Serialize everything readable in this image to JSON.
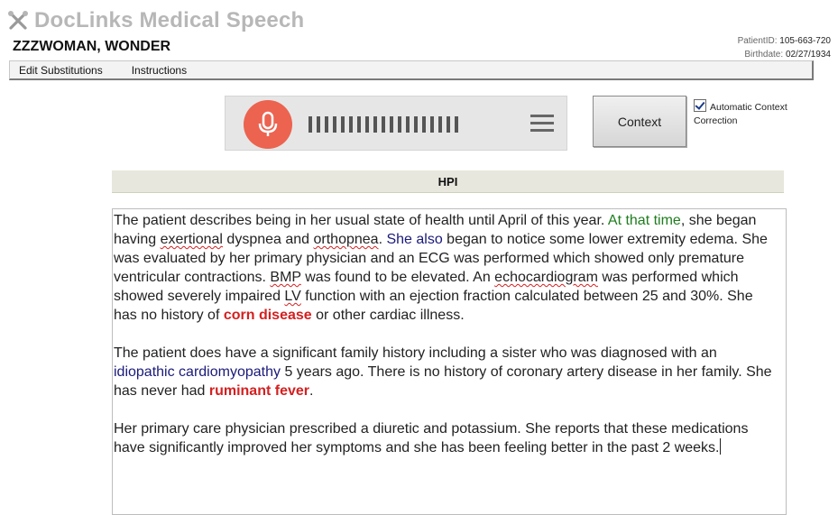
{
  "app": {
    "title": "DocLinks Medical Speech"
  },
  "patient": {
    "name": "ZZZWOMAN, WONDER",
    "id_label": "PatientID:",
    "id_value": "105-663-720",
    "birthdate_label": "Birthdate:",
    "birthdate_value": "02/27/1934"
  },
  "menu": {
    "items": [
      {
        "label": "Edit Substitutions"
      },
      {
        "label": "Instructions"
      }
    ]
  },
  "dictation": {
    "recording": true,
    "mic_color": "#ec6350",
    "level_bars": 19
  },
  "context_button": {
    "label": "Context"
  },
  "auto_context": {
    "checked": true,
    "label": "Automatic Context Correction"
  },
  "section": {
    "title": "HPI"
  },
  "note": {
    "p1": {
      "s1": "The patient describes being in her usual state of health until April of this year. ",
      "ctx1": "At that time",
      "s2": ", she began having ",
      "w1": "exertional",
      "s3": " dyspnea and ",
      "w2": "orthopnea",
      "s4": ". ",
      "term1": "She also",
      "s5": " began to notice some lower extremity edema. She was evaluated by her primary physician and an ECG was performed which showed only premature ventricular contractions. ",
      "w3": "BMP",
      "s6": " was found to be elevated. An ",
      "w4": "echocardiogram",
      "s7": " was performed which showed severely impaired ",
      "w5": "LV",
      "s8": " function with an ejection fraction calculated between 25 and 30%. She has no history of ",
      "err1": "corn disease",
      "s9": " or other cardiac illness."
    },
    "p2": {
      "s1": "The patient does have a significant family history including a sister who was diagnosed with an ",
      "term1": "idiopathic cardiomyopathy",
      "s2": " 5 years ago. There is no history of coronary artery disease in her family. She has never had ",
      "err1": "ruminant fever",
      "s3": "."
    },
    "p3": {
      "s1": "Her primary care physician prescribed a diuretic and potassium. She reports that these medications have significantly improved her symptoms and she has been feeling better in the past 2 weeks."
    }
  },
  "colors": {
    "context_phrase": "#1e7d1e",
    "recognized_term": "#1a1a7a",
    "flagged_error": "#d42020",
    "header_bg": "#e7e7dd"
  }
}
